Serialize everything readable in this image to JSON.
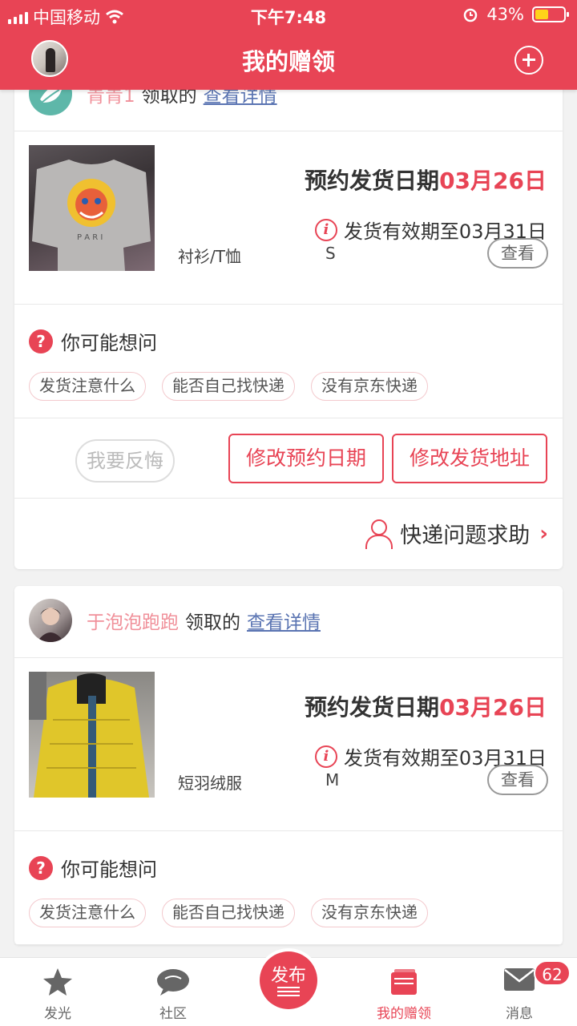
{
  "status_bar": {
    "carrier": "中国移动",
    "time": "下午7:48",
    "battery": "43%"
  },
  "nav": {
    "title": "我的赠领"
  },
  "cards": [
    {
      "nickname": "青青1",
      "taken_label": "领取的",
      "detail_link": "查看详情",
      "appointment_label": "预约发货日期",
      "appointment_date": "03月26日",
      "valid_text": "发货有效期至03月31日",
      "product_name": "衬衫/T恤",
      "size": "S",
      "view_label": "查看",
      "ask_title": "你可能想问",
      "chips": [
        "发货注意什么",
        "能否自己找快递",
        "没有京东快递"
      ],
      "regret_label": "我要反悔",
      "modify_date_label": "修改预约日期",
      "modify_address_label": "修改发货地址",
      "help_label": "快递问题求助"
    },
    {
      "nickname": "于泡泡跑跑",
      "taken_label": "领取的",
      "detail_link": "查看详情",
      "appointment_label": "预约发货日期",
      "appointment_date": "03月26日",
      "valid_text": "发货有效期至03月31日",
      "product_name": "短羽绒服",
      "size": "M",
      "view_label": "查看",
      "ask_title": "你可能想问",
      "chips": [
        "发货注意什么",
        "能否自己找快递",
        "没有京东快递"
      ]
    }
  ],
  "tabbar": {
    "tabs": [
      {
        "label": "发光",
        "icon": "star-icon"
      },
      {
        "label": "社区",
        "icon": "chat-bubble-icon"
      },
      {
        "label": "发布",
        "icon": "publish-icon"
      },
      {
        "label": "我的赠领",
        "icon": "gift-box-icon"
      },
      {
        "label": "消息",
        "icon": "mail-icon"
      }
    ],
    "message_badge": "62"
  },
  "colors": {
    "brand_red": "#e84455",
    "nickname_pink": "#f0909a",
    "link_blue": "#5a74b2"
  }
}
